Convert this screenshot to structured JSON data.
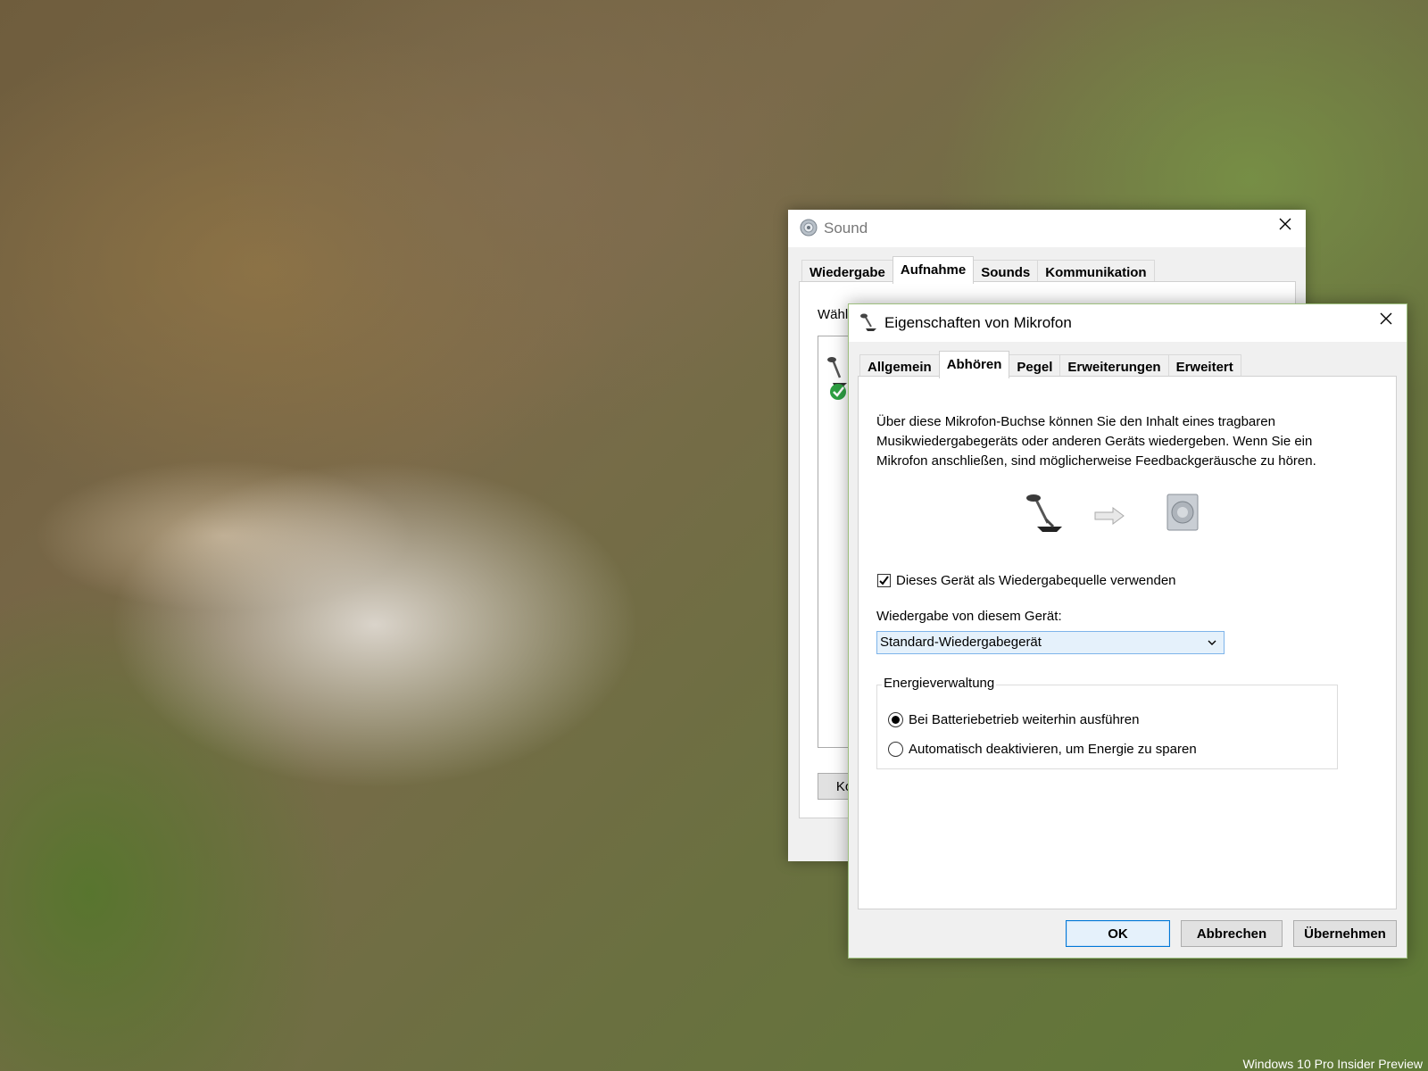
{
  "desktop": {
    "watermark": "Windows 10 Pro Insider Preview"
  },
  "sound_window": {
    "title": "Sound",
    "icon": "speaker-icon",
    "tabs": [
      "Wiedergabe",
      "Aufnahme",
      "Sounds",
      "Kommunikation"
    ],
    "active_tab": "Aufnahme",
    "partial_label": "Wähl",
    "partial_button": "Ko"
  },
  "props_window": {
    "title": "Eigenschaften von Mikrofon",
    "icon": "microphone-icon",
    "tabs": [
      "Allgemein",
      "Abhören",
      "Pegel",
      "Erweiterungen",
      "Erweitert"
    ],
    "active_tab": "Abhören",
    "description": "Über diese Mikrofon-Buchse können Sie den Inhalt eines tragbaren Musikwiedergabegeräts oder anderen Geräts wiedergeben. Wenn Sie ein Mikrofon anschließen, sind möglicherweise Feedbackgeräusche zu hören.",
    "listen_checkbox": {
      "label": "Dieses Gerät als Wiedergabequelle verwenden",
      "checked": true
    },
    "playback_label": "Wiedergabe von diesem Gerät:",
    "playback_device": "Standard-Wiedergabegerät",
    "power": {
      "legend": "Energieverwaltung",
      "options": [
        "Bei Batteriebetrieb weiterhin ausführen",
        "Automatisch deaktivieren, um Energie zu sparen"
      ],
      "selected_index": 0
    },
    "buttons": {
      "ok": "OK",
      "cancel": "Abbrechen",
      "apply": "Übernehmen"
    }
  }
}
